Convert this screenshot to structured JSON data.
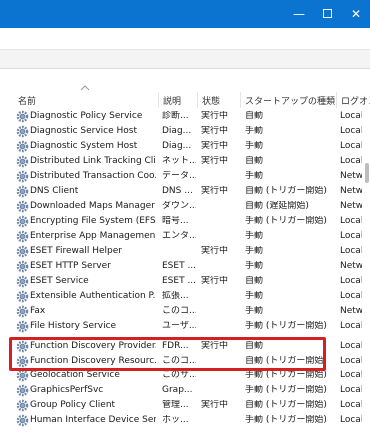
{
  "window": {
    "minimize_glyph": "—",
    "close_glyph": "✕"
  },
  "columns": {
    "name": "名前",
    "description": "説明",
    "status": "状態",
    "startup_type": "スタートアップの種類",
    "logon_as": "ログオン"
  },
  "services": [
    {
      "name": "Diagnostic Policy Service",
      "description": "診断...",
      "status": "実行中",
      "startup_type": "自動",
      "logon_as": "Local"
    },
    {
      "name": "Diagnostic Service Host",
      "description": "Diag...",
      "status": "実行中",
      "startup_type": "手動",
      "logon_as": "Local"
    },
    {
      "name": "Diagnostic System Host",
      "description": "Diag...",
      "status": "実行中",
      "startup_type": "手動",
      "logon_as": "Local"
    },
    {
      "name": "Distributed Link Tracking Cli...",
      "description": "ネット...",
      "status": "実行中",
      "startup_type": "自動",
      "logon_as": "Local"
    },
    {
      "name": "Distributed Transaction Coo...",
      "description": "データ...",
      "status": "",
      "startup_type": "手動",
      "logon_as": "Netwo"
    },
    {
      "name": "DNS Client",
      "description": "DNS ...",
      "status": "実行中",
      "startup_type": "自動 (トリガー開始)",
      "logon_as": "Netwo"
    },
    {
      "name": "Downloaded Maps Manager",
      "description": "ダウン...",
      "status": "",
      "startup_type": "自動 (遅延開始)",
      "logon_as": "Netwo"
    },
    {
      "name": "Encrypting File System (EFS)",
      "description": "暗号...",
      "status": "",
      "startup_type": "手動 (トリガー開始)",
      "logon_as": "Local"
    },
    {
      "name": "Enterprise App Managemen...",
      "description": "エンタ...",
      "status": "",
      "startup_type": "手動",
      "logon_as": "Local"
    },
    {
      "name": "ESET Firewall Helper",
      "description": "",
      "status": "実行中",
      "startup_type": "手動",
      "logon_as": "Local"
    },
    {
      "name": "ESET HTTP Server",
      "description": "ESET ...",
      "status": "",
      "startup_type": "手動",
      "logon_as": "Netwo"
    },
    {
      "name": "ESET Service",
      "description": "ESET ...",
      "status": "実行中",
      "startup_type": "自動",
      "logon_as": "Local"
    },
    {
      "name": "Extensible Authentication P...",
      "description": "拡張...",
      "status": "",
      "startup_type": "手動",
      "logon_as": "Local"
    },
    {
      "name": "Fax",
      "description": "このコ...",
      "status": "",
      "startup_type": "手動",
      "logon_as": "Netwo"
    },
    {
      "name": "File History Service",
      "description": "ユーザ...",
      "status": "",
      "startup_type": "手動 (トリガー開始)",
      "logon_as": "Local"
    },
    {
      "name": "Function Discovery Provider...",
      "description": "FDR...",
      "status": "実行中",
      "startup_type": "自動",
      "logon_as": "Local"
    },
    {
      "name": "Function Discovery Resourc...",
      "description": "このコ...",
      "status": "",
      "startup_type": "自動 (トリガー開始)",
      "logon_as": "Local"
    },
    {
      "name": "Geolocation Service",
      "description": "このサ...",
      "status": "",
      "startup_type": "手動 (トリガー開始)",
      "logon_as": "Local"
    },
    {
      "name": "GraphicsPerfSvc",
      "description": "Grap...",
      "status": "",
      "startup_type": "手動 (トリガー開始)",
      "logon_as": "Local"
    },
    {
      "name": "Group Policy Client",
      "description": "管理...",
      "status": "実行中",
      "startup_type": "自動 (トリガー開始)",
      "logon_as": "Local"
    },
    {
      "name": "Human Interface Device Ser...",
      "description": "ホッ...",
      "status": "",
      "startup_type": "手動 (トリガー開始)",
      "logon_as": "Local"
    }
  ],
  "highlighted_rows": [
    15,
    16
  ],
  "colors": {
    "titlebar": "#0b74d0",
    "highlight_border": "#d42020",
    "icon_gear": "#6f87a8"
  }
}
